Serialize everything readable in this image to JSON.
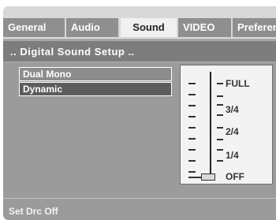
{
  "tabs": [
    {
      "label": "General",
      "active": false
    },
    {
      "label": "Audio",
      "active": false
    },
    {
      "label": "Sound",
      "active": true
    },
    {
      "label": "VIDEO",
      "active": false
    },
    {
      "label": "Preferen",
      "active": false
    }
  ],
  "section": {
    "title": ".. Digital Sound Setup .."
  },
  "options": [
    {
      "label": "Dual Mono",
      "selected": false
    },
    {
      "label": "Dynamic",
      "selected": true
    }
  ],
  "meter": {
    "labels": [
      "FULL",
      "3/4",
      "2/4",
      "1/4",
      "OFF"
    ],
    "level": 0
  },
  "status": {
    "text": "Set Drc Off"
  },
  "colors": {
    "tab_inactive": "#8f8f8f",
    "tab_active": "#f0f0f0",
    "selected_option": "#5c5c5c"
  }
}
